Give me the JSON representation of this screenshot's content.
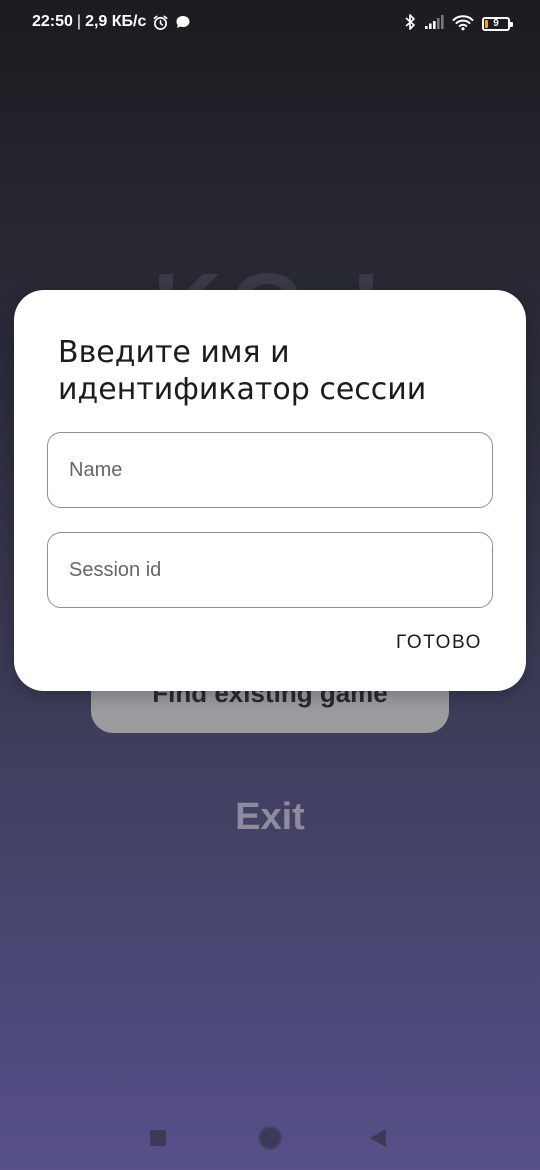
{
  "status_bar": {
    "time": "22:50",
    "separator": "|",
    "network_speed": "2,9 КБ/с",
    "icons": [
      "alarm-icon",
      "message-icon",
      "bluetooth-icon",
      "signal-icon",
      "wifi-icon",
      "battery-icon"
    ],
    "battery_level": "9"
  },
  "background": {
    "logo_text": "KG-I",
    "find_game_button": "Find existing game",
    "exit_button": "Exit"
  },
  "dialog": {
    "title": "Введите имя и идентификатор сессии",
    "name_field": {
      "placeholder": "Name",
      "value": ""
    },
    "session_field": {
      "placeholder": "Session id",
      "value": ""
    },
    "done_button": "ГОТОВО"
  },
  "nav_bar": {
    "icons": [
      "recents-icon",
      "home-icon",
      "back-icon"
    ]
  }
}
